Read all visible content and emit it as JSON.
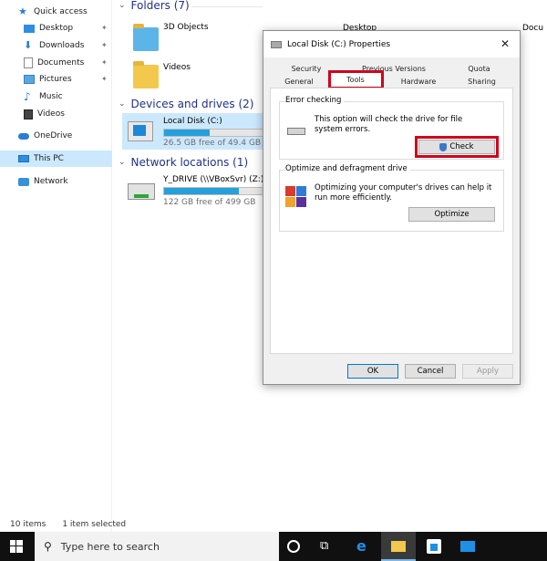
{
  "nav": {
    "quick_access": "Quick access",
    "items": [
      {
        "label": "Desktop",
        "pinned": true
      },
      {
        "label": "Downloads",
        "pinned": true
      },
      {
        "label": "Documents",
        "pinned": true
      },
      {
        "label": "Pictures",
        "pinned": true
      },
      {
        "label": "Music",
        "pinned": false
      },
      {
        "label": "Videos",
        "pinned": false
      }
    ],
    "onedrive": "OneDrive",
    "this_pc": "This PC",
    "network": "Network"
  },
  "content": {
    "folders_header": "Folders (7)",
    "folders": [
      "3D Objects",
      "Videos",
      "Desktop",
      "Docu"
    ],
    "devices_header": "Devices and drives (2)",
    "local_disk": {
      "name": "Local Disk (C:)",
      "free": "26.5 GB free of 49.4 GB",
      "used_fraction": 0.46
    },
    "network_header": "Network locations (1)",
    "network_drive": {
      "name": "Y_DRIVE (\\\\VBoxSvr) (Z:)",
      "free": "122 GB free of 499 GB",
      "used_fraction": 0.76
    }
  },
  "status": {
    "items": "10 items",
    "selected": "1 item selected"
  },
  "taskbar": {
    "search_placeholder": "Type here to search"
  },
  "dialog": {
    "title": "Local Disk (C:) Properties",
    "tabs_row1": [
      "Security",
      "Previous Versions",
      "Quota"
    ],
    "tabs_row2": [
      "General",
      "Tools",
      "Hardware",
      "Sharing"
    ],
    "active_tab": "Tools",
    "error_checking": {
      "legend": "Error checking",
      "description": "This option will check the drive for file system errors.",
      "button": "Check"
    },
    "optimize": {
      "legend": "Optimize and defragment drive",
      "description": "Optimizing your computer's drives can help it run more efficiently.",
      "button": "Optimize"
    },
    "footer": {
      "ok": "OK",
      "cancel": "Cancel",
      "apply": "Apply"
    }
  },
  "colors": {
    "accent": "#26a0da",
    "highlight": "#d0021b",
    "selection": "#cce8ff"
  }
}
